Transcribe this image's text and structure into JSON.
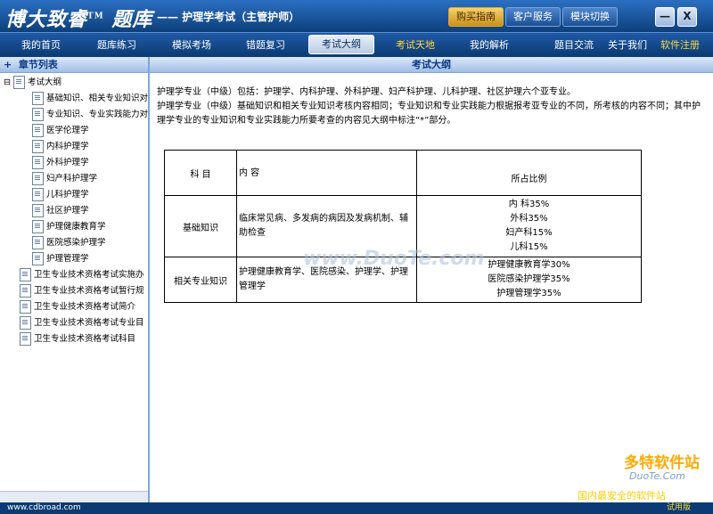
{
  "app": {
    "logo": "博大致睿",
    "logo_tm": "TM",
    "logo_suffix": "题库",
    "subtitle": "—— 护理学考试（主管护师）"
  },
  "top_buttons": [
    "购买指南",
    "客户服务",
    "模块切换"
  ],
  "window_buttons": {
    "minimize": "—",
    "close": "X"
  },
  "nav": {
    "items": [
      "我的首页",
      "题库练习",
      "模拟考场",
      "错题复习",
      "考试大纲",
      "考试天地",
      "我的解析"
    ],
    "active": "考试大纲",
    "right_items": [
      "题目交流",
      "关于我们",
      "软件注册"
    ]
  },
  "sidebar": {
    "title": "章节列表",
    "root": "考试大纲",
    "children": [
      "基础知识、相关专业知识对",
      "专业知识、专业实践能力对",
      "医学伦理学",
      "内科护理学",
      "外科护理学",
      "妇产科护理学",
      "儿科护理学",
      "社区护理学",
      "护理健康教育学",
      "医院感染护理学",
      "护理管理学"
    ],
    "others": [
      "卫生专业技术资格考试实施办",
      "卫生专业技术资格考试暂行规",
      "卫生专业技术资格考试简介",
      "卫生专业技术资格考试专业目",
      "卫生专业技术资格考试科目"
    ]
  },
  "main": {
    "title": "考试大纲",
    "intro1": "护理学专业（中级）包括：护理学、内科护理、外科护理、妇产科护理、儿科护理、社区护理六个亚专业。",
    "intro2": "护理学专业（中级）基础知识和相关专业知识考核内容相同；专业知识和专业实践能力根据报考亚专业的不同，所考核的内容不同；其中护理学专业的专业知识和专业实践能力所要考查的内容见大纲中标注“*”部分。",
    "table": {
      "headers": [
        "科 目",
        "内 容",
        "所占比例"
      ],
      "rows": [
        {
          "subject": "基础知识",
          "content": "临床常见病、多发病的病因及发病机制、辅助检查",
          "ratios": [
            "内 科35%",
            "外科35%",
            "妇产科15%",
            "儿科15%"
          ]
        },
        {
          "subject": "相关专业知识",
          "content": "护理健康教育学、医院感染、护理学、护理管理学",
          "ratios": [
            "护理健康教育学30%",
            "医院感染护理学35%",
            "护理管理学35%"
          ]
        }
      ]
    }
  },
  "watermark": "www.DuoTe.com",
  "brand": {
    "name": "多特软件站",
    "url": "DuoTe.Com",
    "slogan": "国内最安全的软件站"
  },
  "status": {
    "url": "www.cdbroad.com",
    "edition": "试用版"
  }
}
